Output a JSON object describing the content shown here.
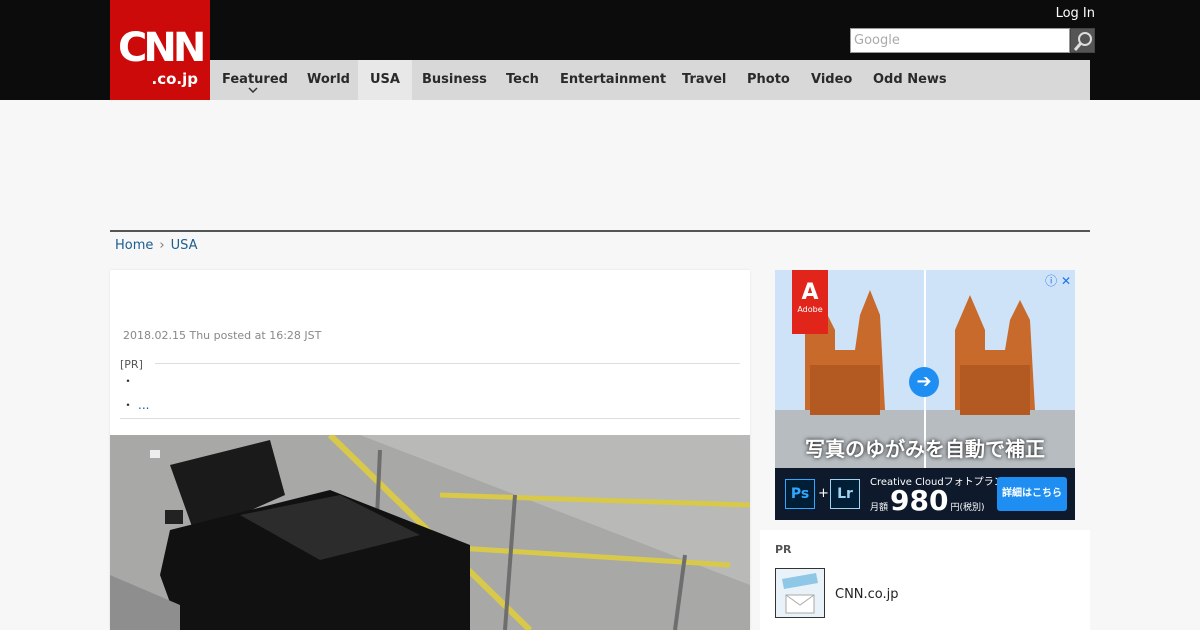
{
  "header": {
    "logo_mark": "CNN",
    "logo_sub": ".co.jp",
    "login": "Log In",
    "search_placeholder": "Google",
    "nav": [
      "Featured",
      "World",
      "USA",
      "Business",
      "Tech",
      "Entertainment",
      "Travel",
      "Photo",
      "Video",
      "Odd News"
    ],
    "active_nav": "USA"
  },
  "breadcrumb": {
    "home": "Home",
    "section": "USA"
  },
  "article": {
    "date": "2018.02.15 Thu posted at 16:28 JST",
    "pr_label": "[PR]",
    "bullet1": "・",
    "bullet2": "・",
    "more": "..."
  },
  "ad": {
    "brand": "Adobe",
    "headline": "写真のゆがみを自動で補正",
    "product": "Creative Cloudフォトプラン",
    "price_prefix": "月額",
    "price": "980",
    "price_suffix": "円(税別)",
    "cta": "詳細はこちら",
    "ps": "Ps",
    "lr": "Lr"
  },
  "pr_box": {
    "label": "PR",
    "item_title": "CNN.co.jp"
  },
  "colors": {
    "brand_red": "#cc0a0a",
    "link": "#1a5e93"
  }
}
